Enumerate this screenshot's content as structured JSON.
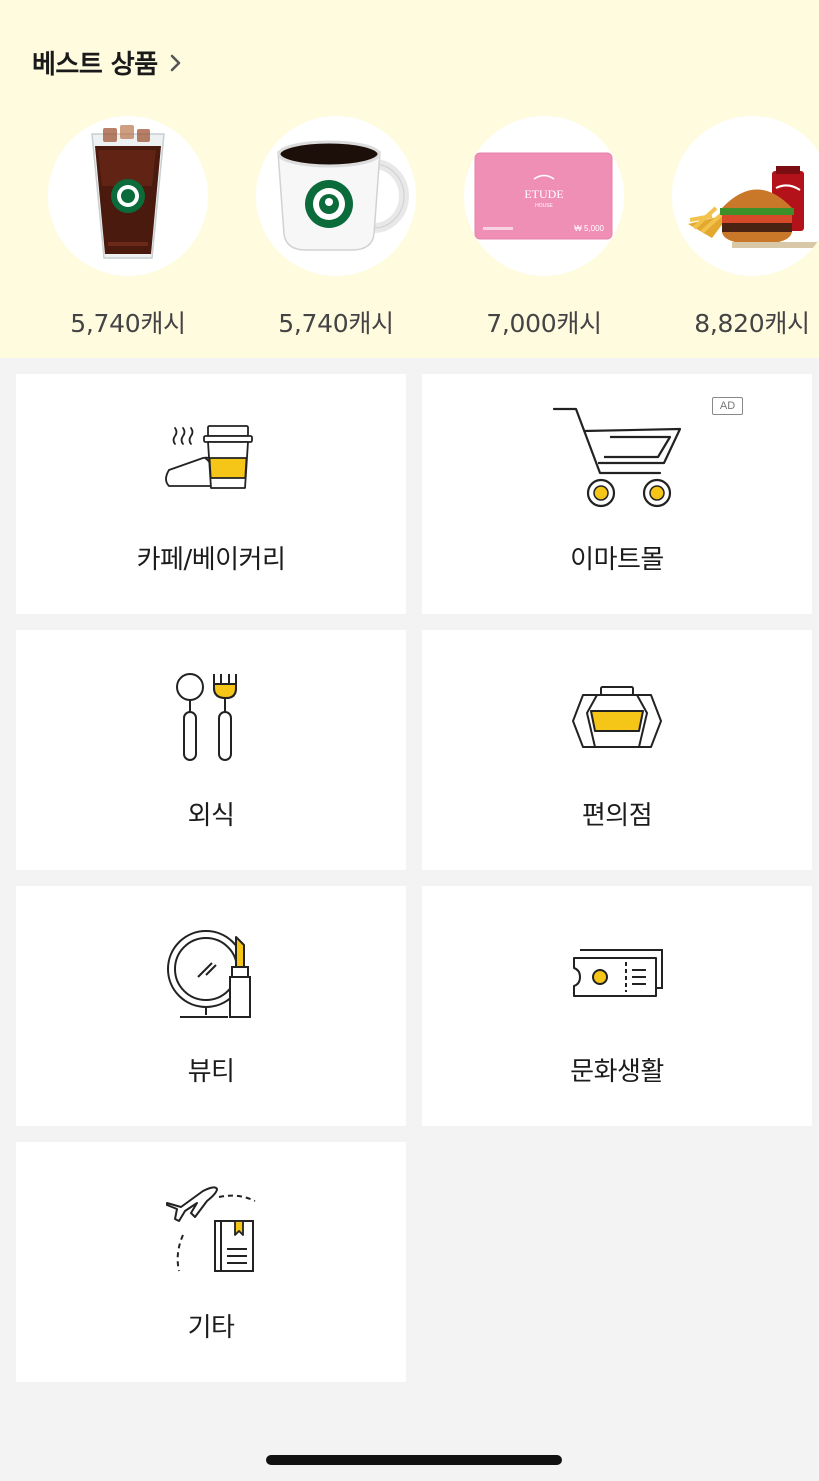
{
  "best": {
    "title": "베스트 상품",
    "products": [
      {
        "name": "Starbucks iced americano",
        "price": "5,740캐시"
      },
      {
        "name": "Starbucks hot coffee",
        "price": "5,740캐시"
      },
      {
        "name": "Etude House gift card",
        "price": "7,000캐시",
        "card_brand": "ETUDE",
        "card_sub": "HOUSE",
        "card_value": "₩ 5,000"
      },
      {
        "name": "Burger set",
        "price": "8,820캐시"
      }
    ]
  },
  "categories": [
    {
      "label": "카페/베이커리",
      "icon": "cafe-bakery-icon"
    },
    {
      "label": "이마트몰",
      "icon": "shopping-cart-icon",
      "badge": "AD"
    },
    {
      "label": "외식",
      "icon": "spoon-fork-icon"
    },
    {
      "label": "편의점",
      "icon": "convenience-store-icon"
    },
    {
      "label": "뷰티",
      "icon": "mirror-lipstick-icon"
    },
    {
      "label": "문화생활",
      "icon": "ticket-icon"
    },
    {
      "label": "기타",
      "icon": "airplane-book-icon"
    }
  ],
  "colors": {
    "accent": "#f5c518",
    "background": "#f3f3f3",
    "best_bg": "#fefbde",
    "line": "#222222"
  }
}
